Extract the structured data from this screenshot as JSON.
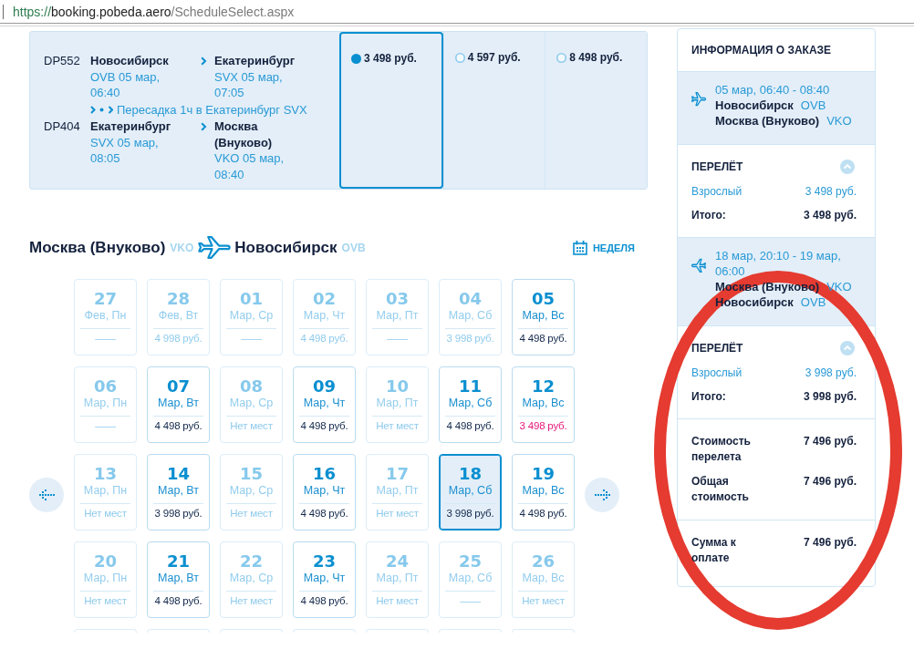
{
  "address_bar": {
    "scheme": "https://",
    "host": "booking.pobeda.aero",
    "path": "/ScheduleSelect.aspx"
  },
  "flight_option": {
    "legs": [
      {
        "flight": "DP552",
        "from_city": "Новосибирск",
        "from_detail": "OVB 05 мар, 06:40",
        "to_city": "Екатеринбург",
        "to_detail": "SVX 05 мар, 07:05"
      },
      {
        "flight": "DP404",
        "from_city": "Екатеринбург",
        "from_detail": "SVX 05 мар, 08:05",
        "to_city": "Москва (Внуково)",
        "to_detail": "VKO 05 мар, 08:40"
      }
    ],
    "transfer": "Пересадка 1ч в Екатеринбург SVX",
    "fares": [
      {
        "price": "3 498 руб.",
        "selected": true
      },
      {
        "price": "4 597 руб.",
        "selected": false
      },
      {
        "price": "8 498 руб.",
        "selected": false
      }
    ]
  },
  "route_header": {
    "from_city": "Москва (Внуково)",
    "from_code": "VKO",
    "to_city": "Новосибирск",
    "to_code": "OVB"
  },
  "week_toggle": {
    "label": "НЕДЕЛЯ"
  },
  "calendar": {
    "weeks": [
      [
        {
          "day": "27",
          "date": "Фев, Пн",
          "price": "——",
          "disabled": true,
          "selected": false,
          "lowest": false
        },
        {
          "day": "28",
          "date": "Фев, Вт",
          "price": "4 998 руб.",
          "disabled": true,
          "selected": false,
          "lowest": false
        },
        {
          "day": "01",
          "date": "Мар, Ср",
          "price": "——",
          "disabled": true,
          "selected": false,
          "lowest": false
        },
        {
          "day": "02",
          "date": "Мар, Чт",
          "price": "4 498 руб.",
          "disabled": true,
          "selected": false,
          "lowest": false
        },
        {
          "day": "03",
          "date": "Мар, Пт",
          "price": "——",
          "disabled": true,
          "selected": false,
          "lowest": false
        },
        {
          "day": "04",
          "date": "Мар, Сб",
          "price": "3 998 руб.",
          "disabled": true,
          "selected": false,
          "lowest": false
        },
        {
          "day": "05",
          "date": "Мар, Вс",
          "price": "4 498 руб.",
          "disabled": false,
          "selected": false,
          "lowest": false
        }
      ],
      [
        {
          "day": "06",
          "date": "Мар, Пн",
          "price": "——",
          "disabled": true,
          "selected": false,
          "lowest": false
        },
        {
          "day": "07",
          "date": "Мар, Вт",
          "price": "4 498 руб.",
          "disabled": false,
          "selected": false,
          "lowest": false
        },
        {
          "day": "08",
          "date": "Мар, Ср",
          "price": "Нет мест",
          "disabled": true,
          "selected": false,
          "lowest": false
        },
        {
          "day": "09",
          "date": "Мар, Чт",
          "price": "4 498 руб.",
          "disabled": false,
          "selected": false,
          "lowest": false
        },
        {
          "day": "10",
          "date": "Мар, Пт",
          "price": "Нет мест",
          "disabled": true,
          "selected": false,
          "lowest": false
        },
        {
          "day": "11",
          "date": "Мар, Сб",
          "price": "4 498 руб.",
          "disabled": false,
          "selected": false,
          "lowest": false
        },
        {
          "day": "12",
          "date": "Мар, Вс",
          "price": "3 498 руб.",
          "disabled": false,
          "selected": false,
          "lowest": true
        }
      ],
      [
        {
          "day": "13",
          "date": "Мар, Пн",
          "price": "Нет мест",
          "disabled": true,
          "selected": false,
          "lowest": false
        },
        {
          "day": "14",
          "date": "Мар, Вт",
          "price": "3 998 руб.",
          "disabled": false,
          "selected": false,
          "lowest": false
        },
        {
          "day": "15",
          "date": "Мар, Ср",
          "price": "Нет мест",
          "disabled": true,
          "selected": false,
          "lowest": false
        },
        {
          "day": "16",
          "date": "Мар, Чт",
          "price": "4 498 руб.",
          "disabled": false,
          "selected": false,
          "lowest": false
        },
        {
          "day": "17",
          "date": "Мар, Пт",
          "price": "Нет мест",
          "disabled": true,
          "selected": false,
          "lowest": false
        },
        {
          "day": "18",
          "date": "Мар, Сб",
          "price": "3 998 руб.",
          "disabled": false,
          "selected": true,
          "lowest": false
        },
        {
          "day": "19",
          "date": "Мар, Вс",
          "price": "4 498 руб.",
          "disabled": false,
          "selected": false,
          "lowest": false
        }
      ],
      [
        {
          "day": "20",
          "date": "Мар, Пн",
          "price": "Нет мест",
          "disabled": true,
          "selected": false,
          "lowest": false
        },
        {
          "day": "21",
          "date": "Мар, Вт",
          "price": "4 498 руб.",
          "disabled": false,
          "selected": false,
          "lowest": false
        },
        {
          "day": "22",
          "date": "Мар, Ср",
          "price": "Нет мест",
          "disabled": true,
          "selected": false,
          "lowest": false
        },
        {
          "day": "23",
          "date": "Мар, Чт",
          "price": "4 498 руб.",
          "disabled": false,
          "selected": false,
          "lowest": false
        },
        {
          "day": "24",
          "date": "Мар, Пт",
          "price": "Нет мест",
          "disabled": true,
          "selected": false,
          "lowest": false
        },
        {
          "day": "25",
          "date": "Мар, Сб",
          "price": "——",
          "disabled": true,
          "selected": false,
          "lowest": false
        },
        {
          "day": "26",
          "date": "Мар, Вс",
          "price": "Нет мест",
          "disabled": true,
          "selected": false,
          "lowest": false
        }
      ]
    ]
  },
  "order_summary": {
    "title": "ИНФОРМАЦИЯ О ЗАКАЗЕ",
    "sections": [
      {
        "kind": "segment",
        "inbound": false,
        "time": "05 мар, 06:40 - 08:40",
        "stops": [
          {
            "city": "Новосибирск",
            "code": "OVB"
          },
          {
            "city": "Москва (Внуково)",
            "code": "VKO"
          }
        ]
      },
      {
        "kind": "fare",
        "title": "ПЕРЕЛЁТ",
        "expanded": true,
        "lines": [
          {
            "kind": "passenger",
            "label": "Взрослый",
            "amount": "3 498 руб."
          },
          {
            "kind": "total",
            "label": "Итого:",
            "amount": "3 498 руб."
          }
        ]
      },
      {
        "kind": "segment",
        "inbound": true,
        "time": "18 мар, 20:10 - 19 мар, 06:00",
        "stops": [
          {
            "city": "Москва (Внуково)",
            "code": "VKO"
          },
          {
            "city": "Новосибирск",
            "code": "OVB"
          }
        ]
      },
      {
        "kind": "fare",
        "title": "ПЕРЕЛЁТ",
        "expanded": true,
        "lines": [
          {
            "kind": "passenger",
            "label": "Взрослый",
            "amount": "3 998 руб."
          },
          {
            "kind": "total",
            "label": "Итого:",
            "amount": "3 998 руб."
          }
        ]
      },
      {
        "kind": "summary",
        "lines": [
          {
            "label": "Стоимость перелета",
            "amount": "7 496 руб."
          },
          {
            "label": "Общая стоимость",
            "amount": "7 496 руб."
          }
        ]
      },
      {
        "kind": "payment",
        "lines": [
          {
            "label": "Сумма к оплате",
            "amount": "7 496 руб."
          }
        ]
      }
    ]
  },
  "markup": [
    {
      "kind": "ellipse"
    }
  ]
}
